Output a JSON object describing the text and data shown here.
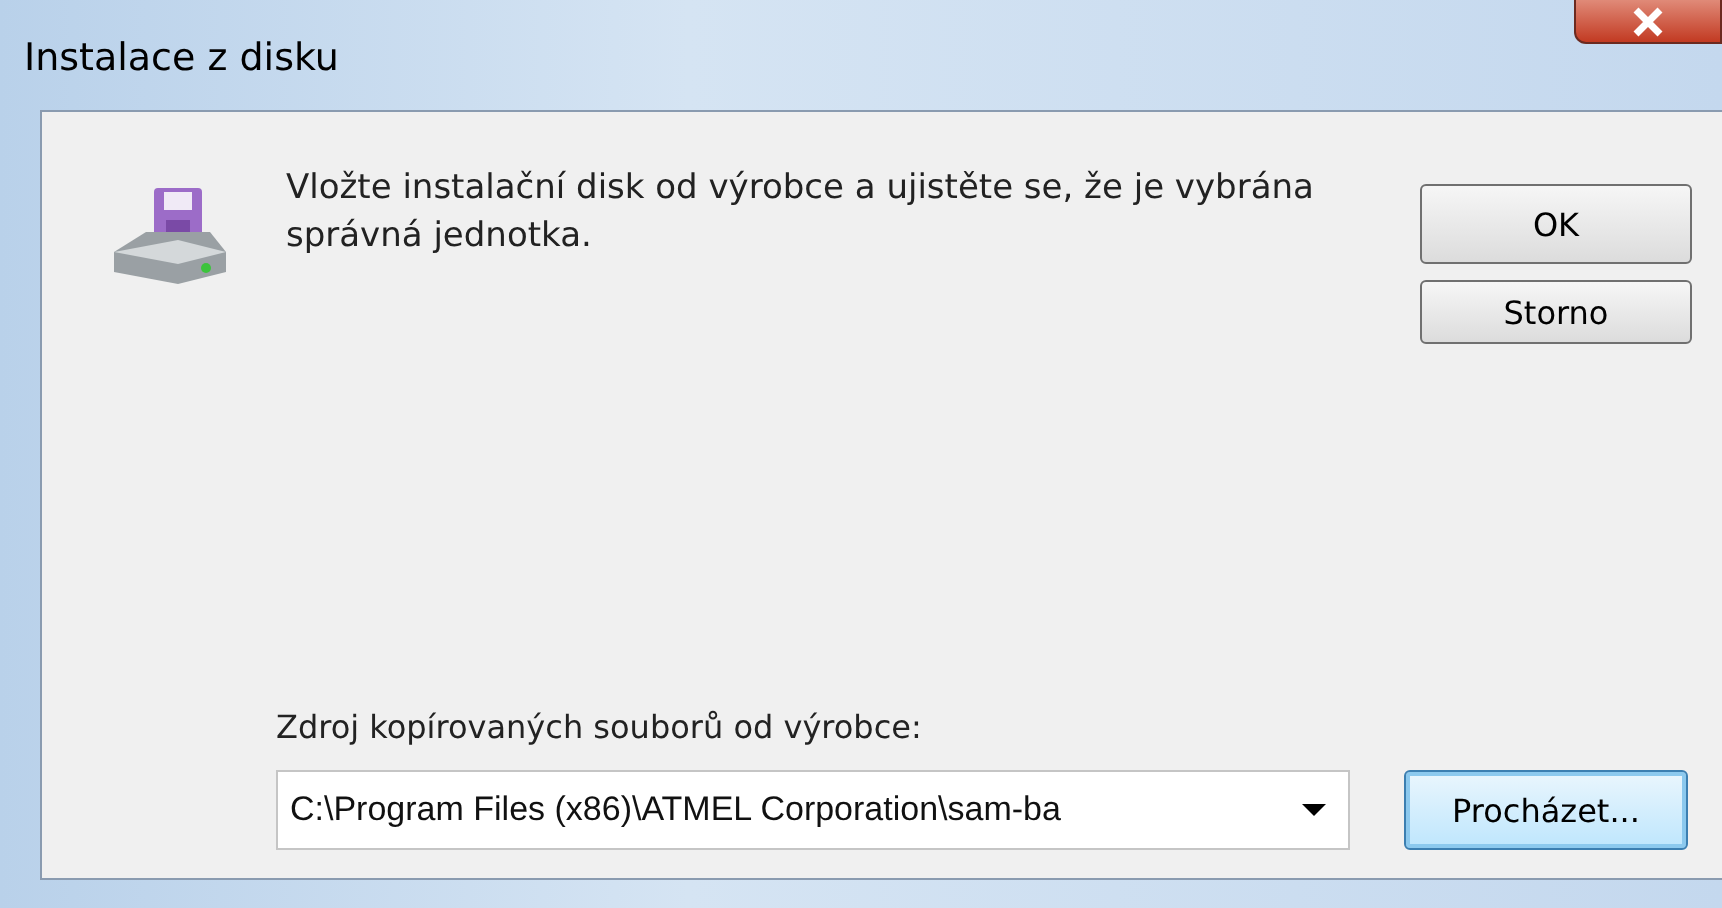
{
  "window": {
    "title": "Instalace z disku"
  },
  "message": "Vložte instalační disk od výrobce a ujistěte se, že je vybrána správná jednotka.",
  "buttons": [
    {
      "label": "OK",
      "focused": false
    },
    {
      "label": "Storno",
      "focused": false
    }
  ],
  "source": {
    "label": "Zdroj kopírovaných souborů od výrobce:",
    "value": "C:\\Program Files (x86)\\ATMEL Corporation\\sam-ba",
    "browse": {
      "label": "Procházet...",
      "focused": true
    }
  }
}
